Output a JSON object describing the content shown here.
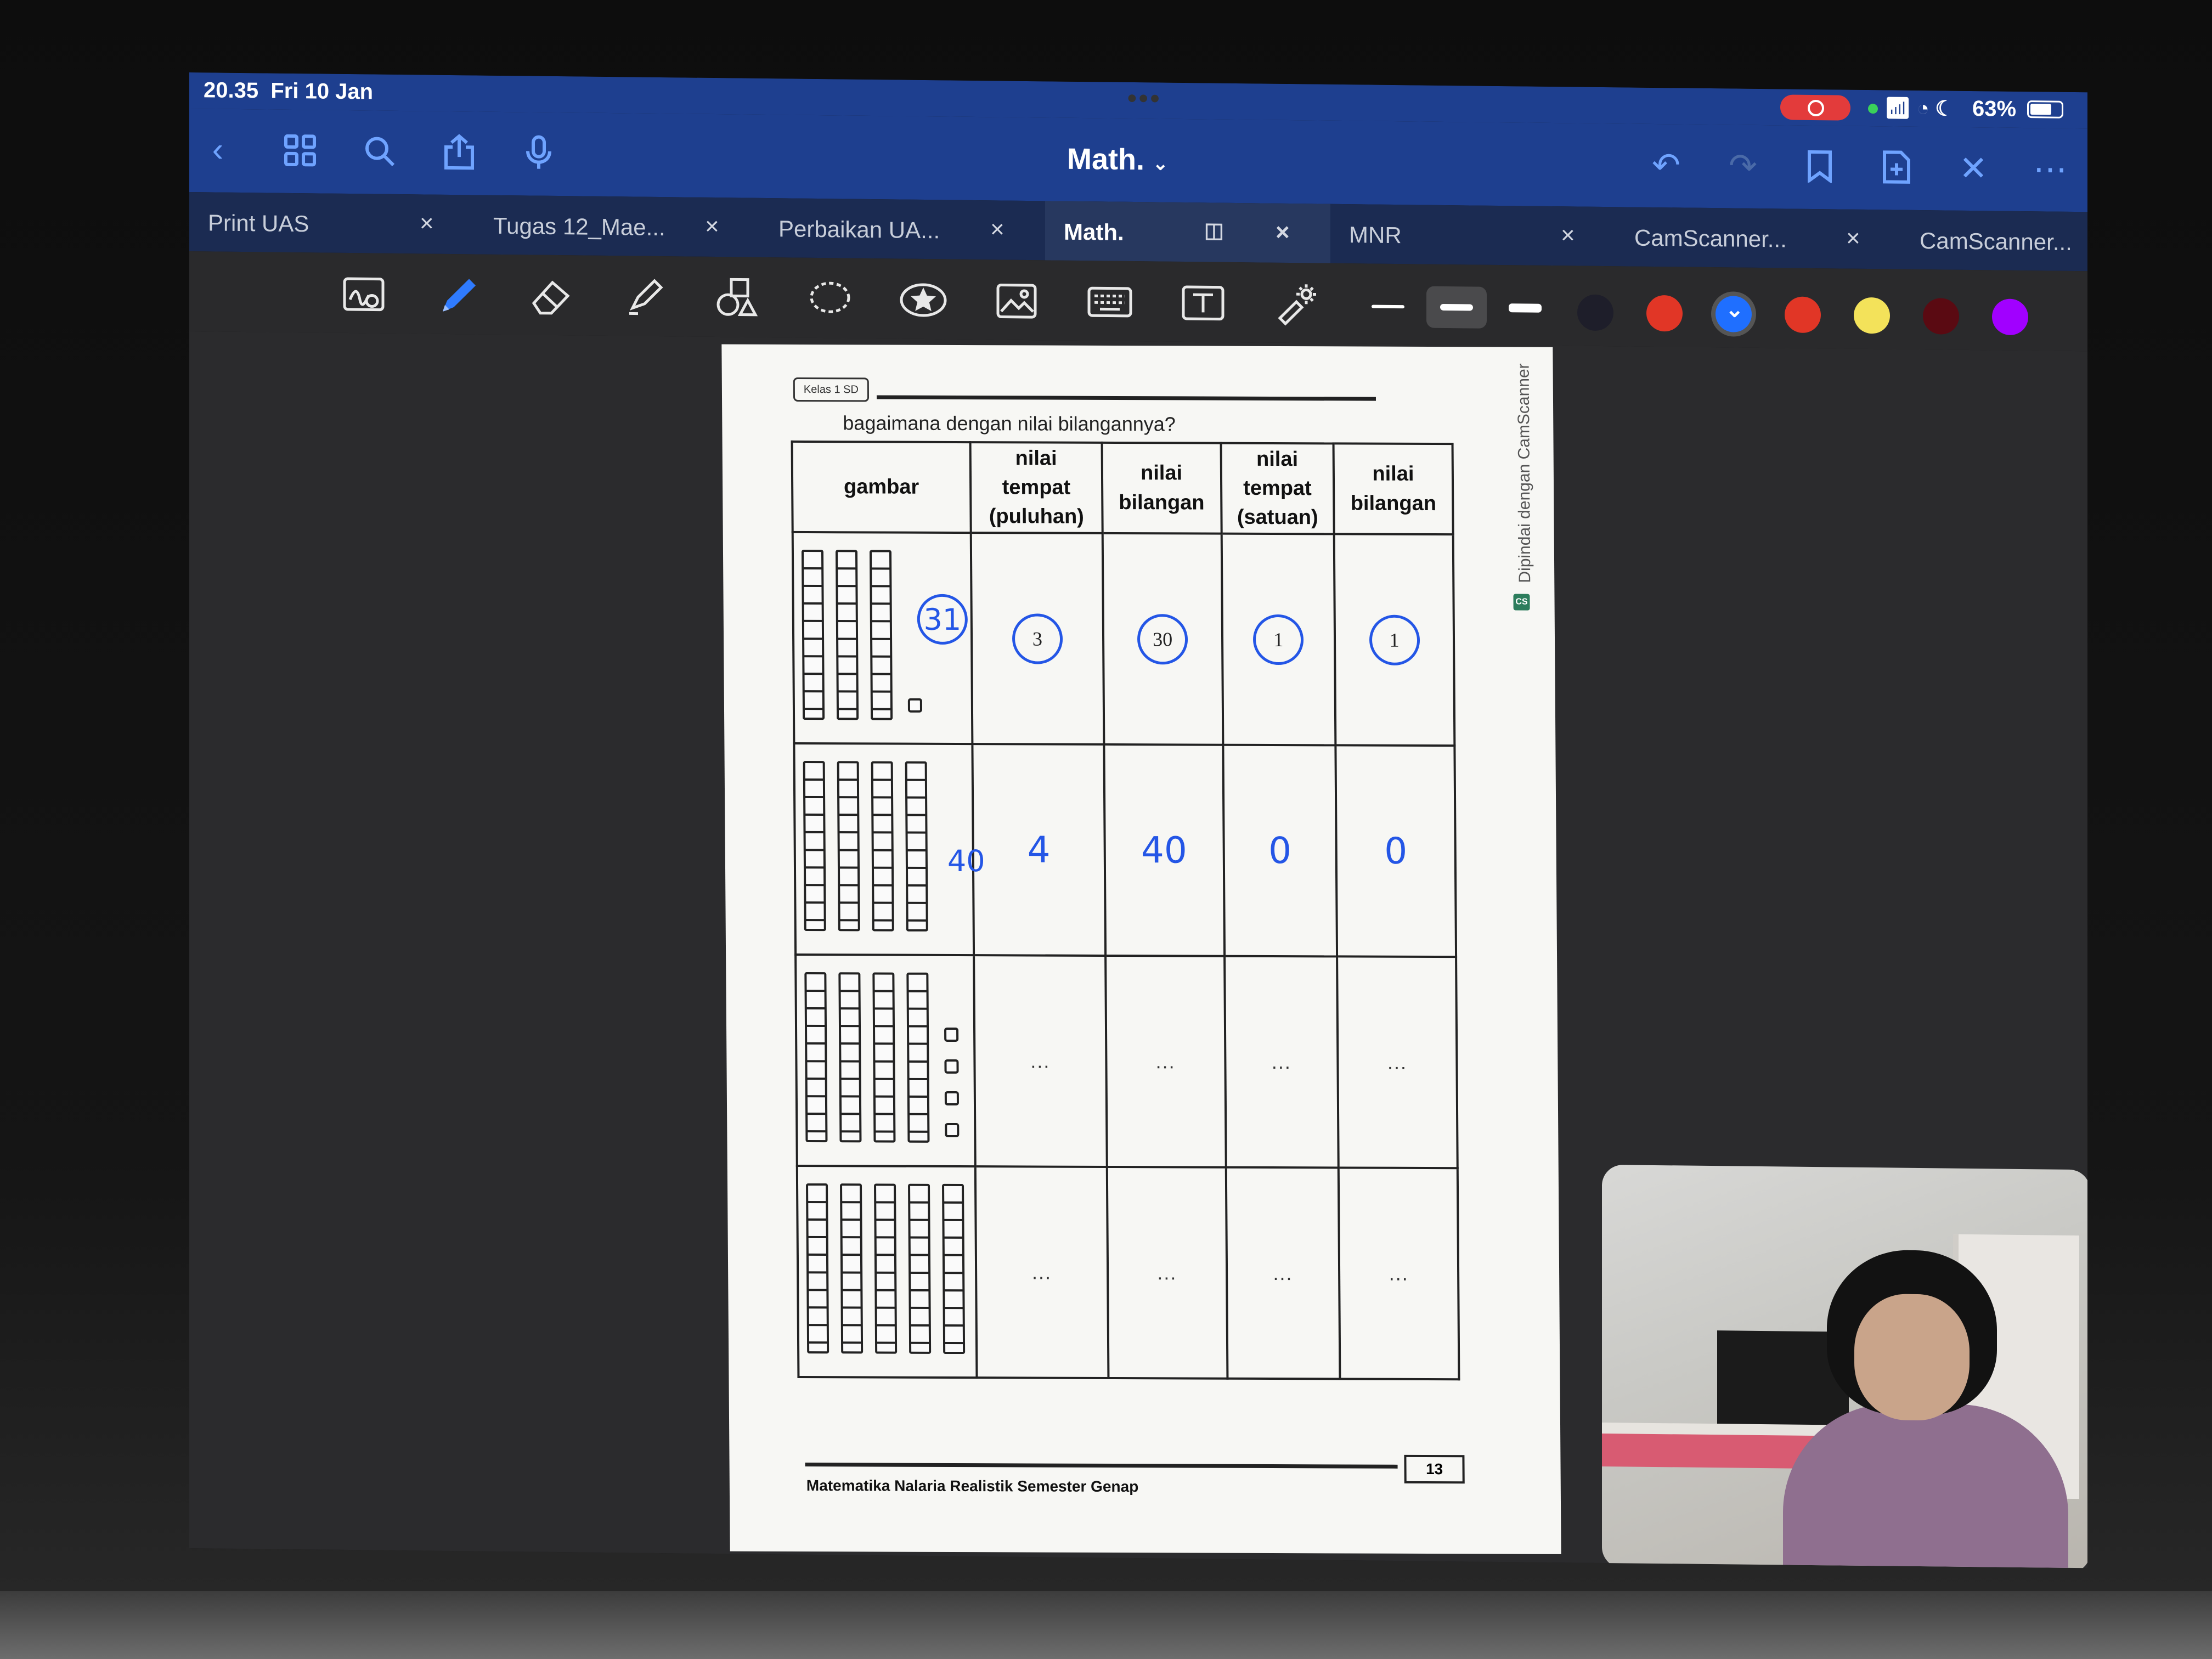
{
  "status_bar": {
    "time": "20.35",
    "date": "Fri 10 Jan",
    "more_dots": "•••",
    "battery": "63%"
  },
  "nav": {
    "title": "Math."
  },
  "tabs": [
    {
      "label": "Print UAS",
      "active": false
    },
    {
      "label": "Tugas 12_Mae...",
      "active": false
    },
    {
      "label": "Perbaikan UA...",
      "active": false
    },
    {
      "label": "Math.",
      "active": true
    },
    {
      "label": "MNR",
      "active": false
    },
    {
      "label": "CamScanner...",
      "active": false
    },
    {
      "label": "CamScanner...",
      "active": false
    }
  ],
  "toolbar": {
    "tools": [
      "zoom-window",
      "pen",
      "eraser",
      "highlighter",
      "shapes",
      "lasso",
      "elements",
      "image",
      "keyboard",
      "text-box",
      "laser-pointer"
    ],
    "selected_tool": "pen",
    "colors": [
      "#1e1e2a",
      "#e13626",
      "#1f6fff",
      "#e13626",
      "#f3e25a",
      "#5a0a12",
      "#a100ff"
    ],
    "selected_color": "#1f6fff"
  },
  "document": {
    "class_label": "Kelas 1 SD",
    "question": "bagaimana dengan nilai bilangannya?",
    "watermark": "Dipindai dengan CamScanner",
    "headers": {
      "gambar": "gambar",
      "tempat_puluhan": "nilai\ntempat\n(puluhan)",
      "bilangan_1": "nilai\nbilangan",
      "tempat_satuan": "nilai\ntempat\n(satuan)",
      "bilangan_2": "nilai\nbilangan"
    },
    "rows": [
      {
        "tens": 3,
        "ones": 1,
        "written_total": "31",
        "answers": [
          "3",
          "30",
          "1",
          "1"
        ],
        "style": "circled"
      },
      {
        "tens": 4,
        "ones": 0,
        "written_total": "40",
        "answers": [
          "4",
          "40",
          "0",
          "0"
        ],
        "style": "handwritten"
      },
      {
        "tens": 4,
        "ones": 4,
        "written_total": "",
        "answers": [
          "...",
          "...",
          "...",
          "..."
        ],
        "style": "blank"
      },
      {
        "tens": 5,
        "ones": 0,
        "written_total": "",
        "answers": [
          "...",
          "...",
          "...",
          "..."
        ],
        "style": "blank"
      }
    ],
    "footer": "Matematika Nalaria Realistik Semester Genap",
    "page_number": "13"
  }
}
